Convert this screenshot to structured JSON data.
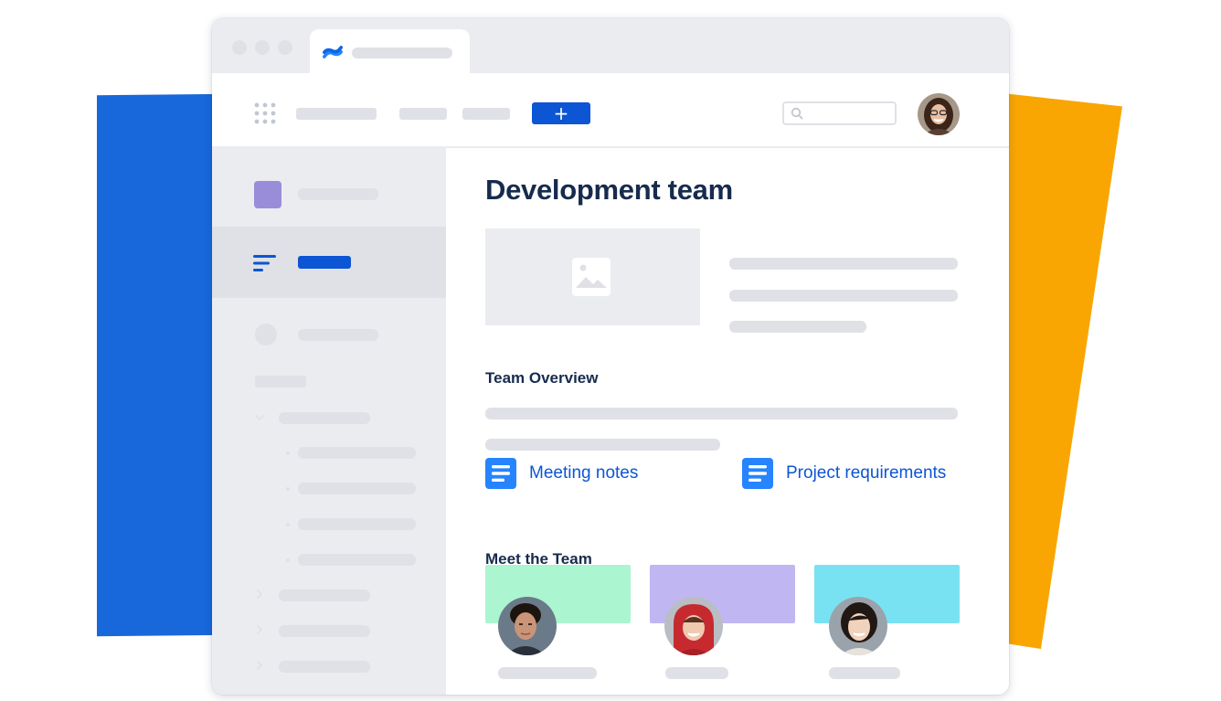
{
  "colors": {
    "brand_blue": "#0c55d4",
    "backdrop_blue": "#1868db",
    "backdrop_orange": "#f9a603",
    "title_text": "#172b4d",
    "placeholder": "#dfe1e6"
  },
  "browser": {
    "tab_icon": "confluence-logo-icon"
  },
  "navbar": {
    "app_switcher_icon": "grid-icon",
    "create_label": "+",
    "search_icon": "search-icon"
  },
  "sidebar": {
    "selected_icon": "menu-lines-icon"
  },
  "page": {
    "title": "Development team",
    "hero_icon": "image-icon",
    "overview_heading": "Team Overview",
    "links": [
      {
        "label": "Meeting notes",
        "icon": "document-icon"
      },
      {
        "label": "Project requirements",
        "icon": "document-icon"
      }
    ],
    "team_heading": "Meet the Team",
    "team_cards": [
      {
        "color": "#abf5d1"
      },
      {
        "color": "#c0b6f2"
      },
      {
        "color": "#79e2f2"
      }
    ]
  }
}
